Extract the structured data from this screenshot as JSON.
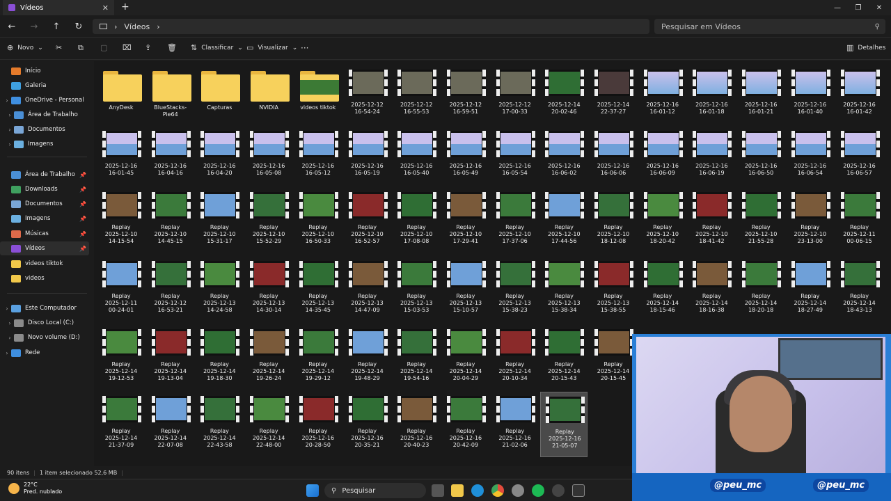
{
  "window": {
    "tab_title": "Vídeos",
    "tab_close": "✕",
    "new_tab": "+",
    "minimize": "—",
    "maximize": "❐",
    "close": "✕"
  },
  "nav": {
    "back": "←",
    "forward": "→",
    "up": "↑",
    "refresh": "↻",
    "breadcrumb_sep": "›",
    "breadcrumb": "Vídeos",
    "breadcrumb_more": "›",
    "search_placeholder": "Pesquisar em Vídeos"
  },
  "toolbar": {
    "new_label": "Novo",
    "sort_label": "Classificar",
    "view_label": "Visualizar",
    "more_label": "···",
    "details_label": "Detalhes"
  },
  "sidebar": {
    "items": [
      {
        "label": "Início",
        "color": "#e57b2b"
      },
      {
        "label": "Galeria",
        "color": "#3fa0e0"
      },
      {
        "label": "OneDrive - Personal",
        "color": "#3f8fe0"
      },
      {
        "label": "Área de Trabalho",
        "color": "#4a8fd6"
      },
      {
        "label": "Documentos",
        "color": "#7aa6d6"
      },
      {
        "label": "Imagens",
        "color": "#6bb0e0"
      },
      {
        "label": "Área de Trabalho",
        "color": "#4a8fd6"
      },
      {
        "label": "Downloads",
        "color": "#3fa05f"
      },
      {
        "label": "Documentos",
        "color": "#7aa6d6"
      },
      {
        "label": "Imagens",
        "color": "#6bb0e0"
      },
      {
        "label": "Músicas",
        "color": "#e06a4a"
      },
      {
        "label": "Vídeos",
        "color": "#8a4fd6"
      },
      {
        "label": "videos tiktok",
        "color": "#f1c84a"
      },
      {
        "label": "videos",
        "color": "#f1c84a"
      },
      {
        "label": "Este Computador",
        "color": "#5aa0e0"
      },
      {
        "label": "Disco Local (C:)",
        "color": "#8a8a8a"
      },
      {
        "label": "Novo volume (D:)",
        "color": "#8a8a8a"
      },
      {
        "label": "Rede",
        "color": "#3f8fe0"
      }
    ]
  },
  "folders": [
    "AnyDesk",
    "BlueStacks-Pie64",
    "Capturas",
    "NVIDIA",
    "videos tiktok"
  ],
  "files": [
    "2025-12-12\n16-54-24",
    "2025-12-12\n16-55-53",
    "2025-12-12\n16-59-51",
    "2025-12-12\n17-00-33",
    "2025-12-14\n20-02-46",
    "2025-12-14\n22-37-27",
    "2025-12-16\n16-01-12",
    "2025-12-16\n16-01-18",
    "2025-12-16\n16-01-21",
    "2025-12-16\n16-01-40",
    "2025-12-16\n16-01-42",
    "2025-12-16\n16-01-45",
    "2025-12-16\n16-04-16",
    "2025-12-16\n16-04-20",
    "2025-12-16\n16-05-08",
    "2025-12-16\n16-05-12",
    "2025-12-16\n16-05-19",
    "2025-12-16\n16-05-40",
    "2025-12-16\n16-05-49",
    "2025-12-16\n16-05-54",
    "2025-12-16\n16-06-02",
    "2025-12-16\n16-06-06",
    "2025-12-16\n16-06-09",
    "2025-12-16\n16-06-19",
    "2025-12-16\n16-06-50",
    "2025-12-16\n16-06-54",
    "2025-12-16\n16-06-57",
    "Replay\n2025-12-10\n14-15-54",
    "Replay\n2025-12-10\n14-45-15",
    "Replay\n2025-12-10\n15-31-17",
    "Replay\n2025-12-10\n15-52-29",
    "Replay\n2025-12-10\n16-50-33",
    "Replay\n2025-12-10\n16-52-57",
    "Replay\n2025-12-10\n17-08-08",
    "Replay\n2025-12-10\n17-29-41",
    "Replay\n2025-12-10\n17-37-06",
    "Replay\n2025-12-10\n17-44-56",
    "Replay\n2025-12-10\n18-12-08",
    "Replay\n2025-12-10\n18-20-42",
    "Replay\n2025-12-10\n18-41-42",
    "Replay\n2025-12-10\n21-55-28",
    "Replay\n2025-12-10\n23-13-00",
    "Replay\n2025-12-11\n00-06-15",
    "Replay\n2025-12-11\n00-24-01",
    "Replay\n2025-12-12\n16-53-21",
    "Replay\n2025-12-13\n14-24-58",
    "Replay\n2025-12-13\n14-30-14",
    "Replay\n2025-12-13\n14-35-45",
    "Replay\n2025-12-13\n14-47-09",
    "Replay\n2025-12-13\n15-03-53",
    "Replay\n2025-12-13\n15-10-57",
    "Replay\n2025-12-13\n15-38-23",
    "Replay\n2025-12-13\n15-38-34",
    "Replay\n2025-12-13\n15-38-55",
    "Replay\n2025-12-14\n18-15-46",
    "Replay\n2025-12-14\n18-16-38",
    "Replay\n2025-12-14\n18-20-18",
    "Replay\n2025-12-14\n18-27-49",
    "Replay\n2025-12-14\n18-43-13",
    "Replay\n2025-12-14\n19-12-53",
    "Replay\n2025-12-14\n19-13-04",
    "Replay\n2025-12-14\n19-18-30",
    "Replay\n2025-12-14\n19-26-24",
    "Replay\n2025-12-14\n19-29-12",
    "Replay\n2025-12-14\n19-48-29",
    "Replay\n2025-12-14\n19-54-16",
    "Replay\n2025-12-14\n20-04-29",
    "Replay\n2025-12-14\n20-10-34",
    "Replay\n2025-12-14\n20-15-43",
    "Replay\n2025-12-14\n20-15-45",
    "Replay\n2025-12-14\n21-37-09",
    "Replay\n2025-12-14\n22-07-08",
    "Replay\n2025-12-14\n22-43-58",
    "Replay\n2025-12-14\n22-48-00",
    "Replay\n2025-12-16\n20-28-50",
    "Replay\n2025-12-16\n20-35-21",
    "Replay\n2025-12-16\n20-40-23",
    "Replay\n2025-12-16\n20-42-09",
    "Replay\n2025-12-16\n21-02-06",
    "Replay\n2025-12-16\n21-05-07"
  ],
  "status": {
    "count": "90 itens",
    "selection": "1 item selecionado  52,6 MB"
  },
  "taskbar": {
    "temp": "22°C",
    "weather": "Pred. nublado",
    "search": "Pesquisar"
  },
  "webcam": {
    "handle": "@peu_mc"
  }
}
